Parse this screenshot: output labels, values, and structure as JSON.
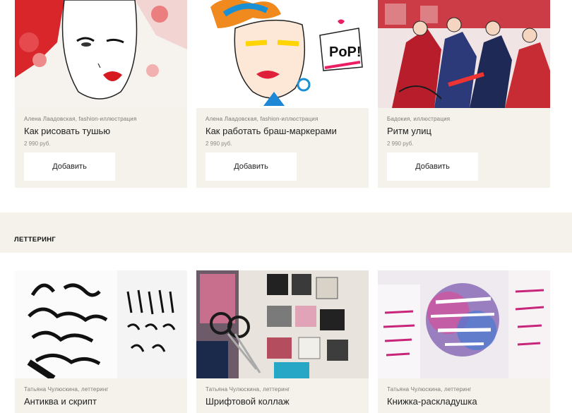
{
  "section_fashion": {
    "cards": [
      {
        "author": "Алена Лаадовская, fashion-иллюстрация",
        "title": "Как рисовать тушью",
        "price": "2 990 руб.",
        "button": "Добавить"
      },
      {
        "author": "Алена Лаадовская, fashion-иллюстрация",
        "title": "Как работать браш-маркерами",
        "price": "2 990 руб.",
        "button": "Добавить"
      },
      {
        "author": "Бадокия, иллюстрация",
        "title": "Ритм улиц",
        "price": "2 990 руб.",
        "button": "Добавить"
      }
    ]
  },
  "section_lettering": {
    "heading": "ЛЕТТЕРИНГ",
    "cards": [
      {
        "author": "Татьяна Чулюскина, леттеринг",
        "title": "Антиква и скрипт"
      },
      {
        "author": "Татьяна Чулюскина, леттеринг",
        "title": "Шрифтовой коллаж"
      },
      {
        "author": "Татьяна Чулюскина, леттеринг",
        "title": "Книжка-раскладушка"
      }
    ]
  },
  "colors": {
    "card_bg": "#f4f2ea",
    "button_bg": "#ffffff",
    "text": "#222222",
    "meta": "#7a7a74"
  }
}
